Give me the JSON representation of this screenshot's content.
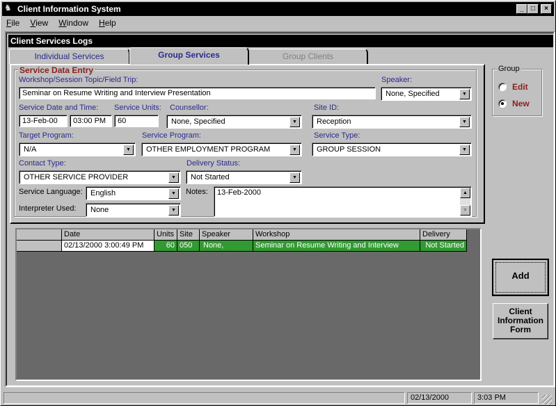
{
  "window": {
    "title": "Client Information System",
    "controls": {
      "minimize": "_",
      "maximize": "□",
      "close": "×"
    }
  },
  "menu": [
    {
      "label": "File",
      "mnemonic": "F",
      "rest": "ile"
    },
    {
      "label": "View",
      "mnemonic": "V",
      "rest": "iew"
    },
    {
      "label": "Window",
      "mnemonic": "W",
      "rest": "indow"
    },
    {
      "label": "Help",
      "mnemonic": "H",
      "rest": "elp"
    }
  ],
  "child_window": {
    "title": "Client Services Logs"
  },
  "tabs": [
    {
      "label": "Individual Services",
      "state": "inactive"
    },
    {
      "label": "Group Services",
      "state": "active"
    },
    {
      "label": "Group Clients",
      "state": "disabled"
    }
  ],
  "form": {
    "section_title": "Service Data Entry",
    "workshop": {
      "label": "Workshop/Session Topic/Field Trip:",
      "value": "Seminar on Resume Writing and Interview Presentation"
    },
    "speaker": {
      "label": "Speaker:",
      "value": "None, Specified"
    },
    "service_date": {
      "label": "Service Date and Time:",
      "date": "13-Feb-00",
      "time": "03:00 PM"
    },
    "service_units": {
      "label": "Service Units:",
      "value": "60"
    },
    "counsellor": {
      "label": "Counsellor:",
      "value": "None, Specified"
    },
    "site_id": {
      "label": "Site ID:",
      "value": "Reception"
    },
    "target_program": {
      "label": "Target Program:",
      "value": "N/A"
    },
    "service_program": {
      "label": "Service Program:",
      "value": "OTHER EMPLOYMENT PROGRAM"
    },
    "service_type": {
      "label": "Service Type:",
      "value": "GROUP SESSION"
    },
    "contact_type": {
      "label": "Contact Type:",
      "value": "OTHER SERVICE PROVIDER"
    },
    "delivery_status": {
      "label": "Delivery Status:",
      "value": "Not Started"
    },
    "service_language": {
      "label": "Service Language:",
      "value": "English"
    },
    "interpreter_used": {
      "label": "Interpreter Used:",
      "value": "None"
    },
    "notes": {
      "label": "Notes:",
      "value": "13-Feb-2000"
    }
  },
  "group_mode": {
    "title": "Group",
    "options": [
      {
        "label": "Edit",
        "selected": false
      },
      {
        "label": "New",
        "selected": true
      }
    ]
  },
  "grid": {
    "columns": [
      "",
      "Date",
      "Units",
      "Site",
      "Speaker",
      "Workshop",
      "Delivery"
    ],
    "rows": [
      {
        "selector": "",
        "date": "02/13/2000 3:00:49 PM",
        "units": "60",
        "site": "050",
        "speaker": "None,",
        "workshop": "Seminar on Resume Writing and Interview",
        "delivery": "Not Started"
      }
    ],
    "row_color": "#339933"
  },
  "buttons": {
    "add": "Add",
    "client_form_line1": "Client",
    "client_form_line2": "Information",
    "client_form_line3": "Form"
  },
  "status_bar": {
    "message": "",
    "date": "02/13/2000",
    "time": "3:03 PM"
  }
}
